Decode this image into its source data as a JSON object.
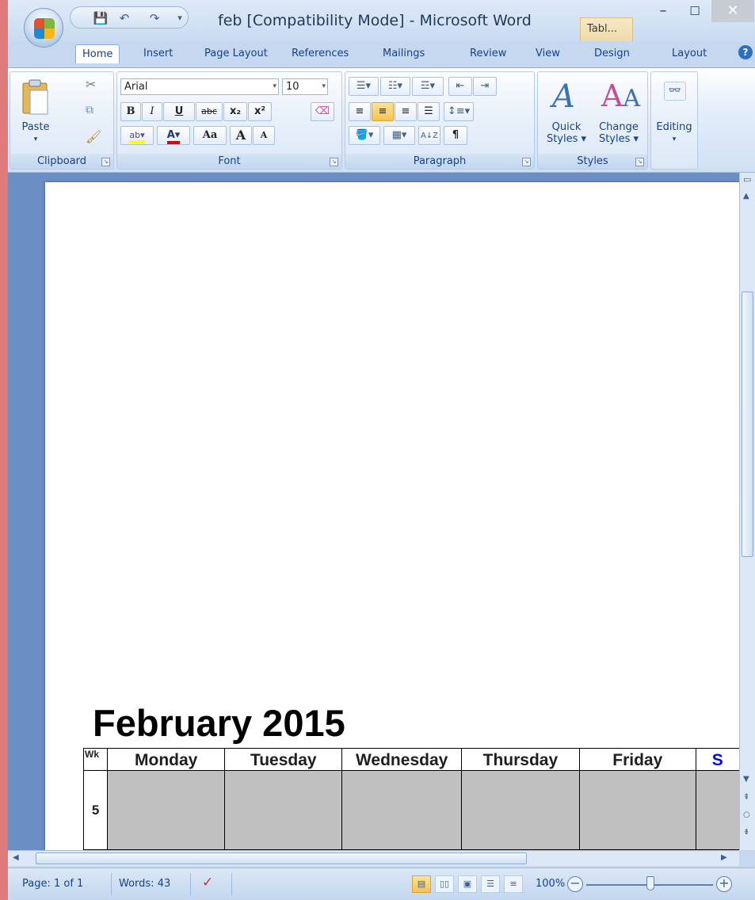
{
  "window": {
    "title": "feb [Compatibility Mode] - Microsoft Word",
    "context_tab": "Tabl...",
    "buttons": {
      "minimize": "–",
      "maximize": "☐",
      "close": "✕"
    }
  },
  "qat": {
    "save": "💾",
    "undo": "↶",
    "redo": "↷",
    "customize": "▾"
  },
  "tabs": [
    {
      "label": "Home"
    },
    {
      "label": "Insert"
    },
    {
      "label": "Page Layout"
    },
    {
      "label": "References"
    },
    {
      "label": "Mailings"
    },
    {
      "label": "Review"
    },
    {
      "label": "View"
    },
    {
      "label": "Design"
    },
    {
      "label": "Layout"
    }
  ],
  "help": "?",
  "ribbon": {
    "clipboard": {
      "label": "Clipboard",
      "paste": "Paste"
    },
    "font": {
      "label": "Font",
      "family": "Arial",
      "size": "10",
      "bold": "B",
      "italic": "I",
      "underline": "U",
      "strike": "abc",
      "subscript": "x₂",
      "superscript": "x²",
      "change_case": "Aa",
      "grow": "A",
      "shrink": "A"
    },
    "paragraph": {
      "label": "Paragraph",
      "pilcrow": "¶"
    },
    "styles": {
      "label": "Styles",
      "quick": "Quick\nStyles ▾",
      "change": "Change\nStyles ▾"
    },
    "editing": {
      "label": "Editing"
    }
  },
  "document": {
    "title": "February 2015",
    "calendar": {
      "headers": [
        "Wk",
        "Monday",
        "Tuesday",
        "Wednesday",
        "Thursday",
        "Friday",
        "S"
      ],
      "rows": [
        {
          "week": "5"
        }
      ]
    }
  },
  "status": {
    "page": "Page: 1 of 1",
    "words": "Words: 43",
    "zoom": "100%",
    "zoom_level_percent": 100
  },
  "colors": {
    "accent": "#15428b",
    "sunday_header": "#0000ff",
    "calendar_fill": "#c0c0c0"
  }
}
